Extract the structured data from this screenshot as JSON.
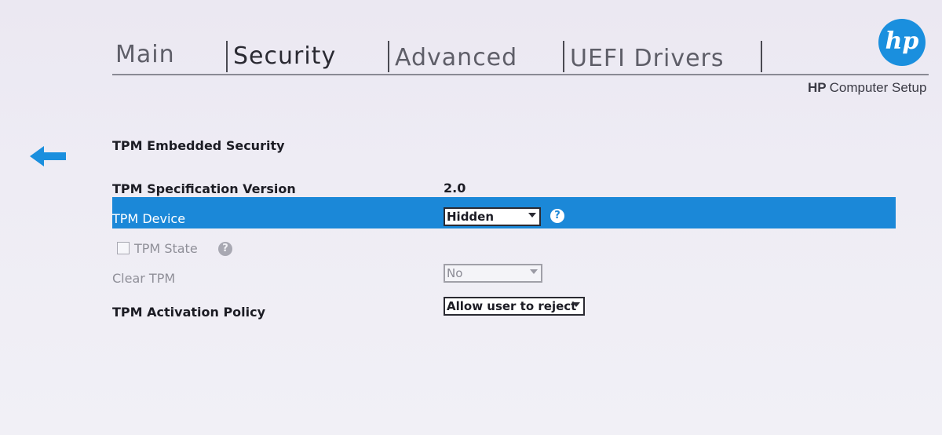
{
  "tabs": [
    {
      "label": "Main"
    },
    {
      "label": "Security"
    },
    {
      "label": "Advanced"
    },
    {
      "label": "UEFI Drivers"
    }
  ],
  "active_tab": "Security",
  "brand": {
    "logo": "hp",
    "bold": "HP",
    "name": "Computer Setup"
  },
  "back_icon": "left-arrow-icon",
  "section_title": "TPM Embedded Security",
  "rows": {
    "spec_version": {
      "label": "TPM Specification Version",
      "value": "2.0"
    },
    "device": {
      "label": "TPM Device",
      "value": "Hidden"
    },
    "state": {
      "label": "TPM State",
      "checked": false
    },
    "clear": {
      "label": "Clear TPM",
      "value": "No"
    },
    "activation": {
      "label": "TPM Activation Policy",
      "value": "Allow user to reject"
    }
  },
  "help_glyph": "?",
  "colors": {
    "accent": "#1b88d8",
    "logo": "#1a8fde"
  }
}
